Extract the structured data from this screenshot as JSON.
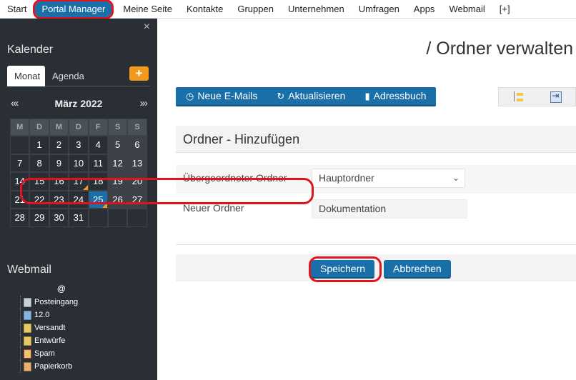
{
  "topnav": {
    "items": [
      "Start",
      "Portal Manager",
      "Meine Seite",
      "Kontakte",
      "Gruppen",
      "Unternehmen",
      "Umfragen",
      "Apps",
      "Webmail",
      "[+]"
    ]
  },
  "sidebar": {
    "close": "×",
    "calendar_title": "Kalender",
    "tabs": [
      "Monat",
      "Agenda"
    ],
    "add": "+",
    "prev": "«‹",
    "next": "›»",
    "month_label": "März 2022",
    "weekdays": [
      "M",
      "D",
      "M",
      "D",
      "F",
      "S",
      "S"
    ],
    "weeks": [
      [
        "",
        "1",
        "2",
        "3",
        "4",
        "5",
        "6"
      ],
      [
        "7",
        "8",
        "9",
        "10",
        "11",
        "12",
        "13"
      ],
      [
        "14",
        "15",
        "16",
        "17",
        "18",
        "19",
        "20"
      ],
      [
        "21",
        "22",
        "23",
        "24",
        "25",
        "26",
        "27"
      ],
      [
        "28",
        "29",
        "30",
        "31",
        "",
        "",
        ""
      ]
    ],
    "today": "25",
    "marked": [
      "17",
      "25"
    ],
    "webmail_title": "Webmail",
    "webmail_account": "@",
    "webmail_folders": [
      "Posteingang",
      "12.0",
      "Versandt",
      "Entwürfe",
      "Spam",
      "Papierkorb"
    ]
  },
  "main": {
    "page_title": "/ Ordner verwalten",
    "toolbar": {
      "new_mails": "Neue E-Mails",
      "refresh": "Aktualisieren",
      "address_book": "Adressbuch"
    },
    "section_title": "Ordner - Hinzufügen",
    "parent_label": "Übergeordneter Ordner",
    "parent_value": "Hauptordner",
    "new_label": "Neuer Ordner",
    "new_value": "Dokumentation",
    "save": "Speichern",
    "cancel": "Abbrechen"
  },
  "colors": {
    "primary": "#1b6fa8",
    "highlight": "#e0141e",
    "accent": "#f39a1e",
    "sidebar_bg": "#2a2f35"
  }
}
